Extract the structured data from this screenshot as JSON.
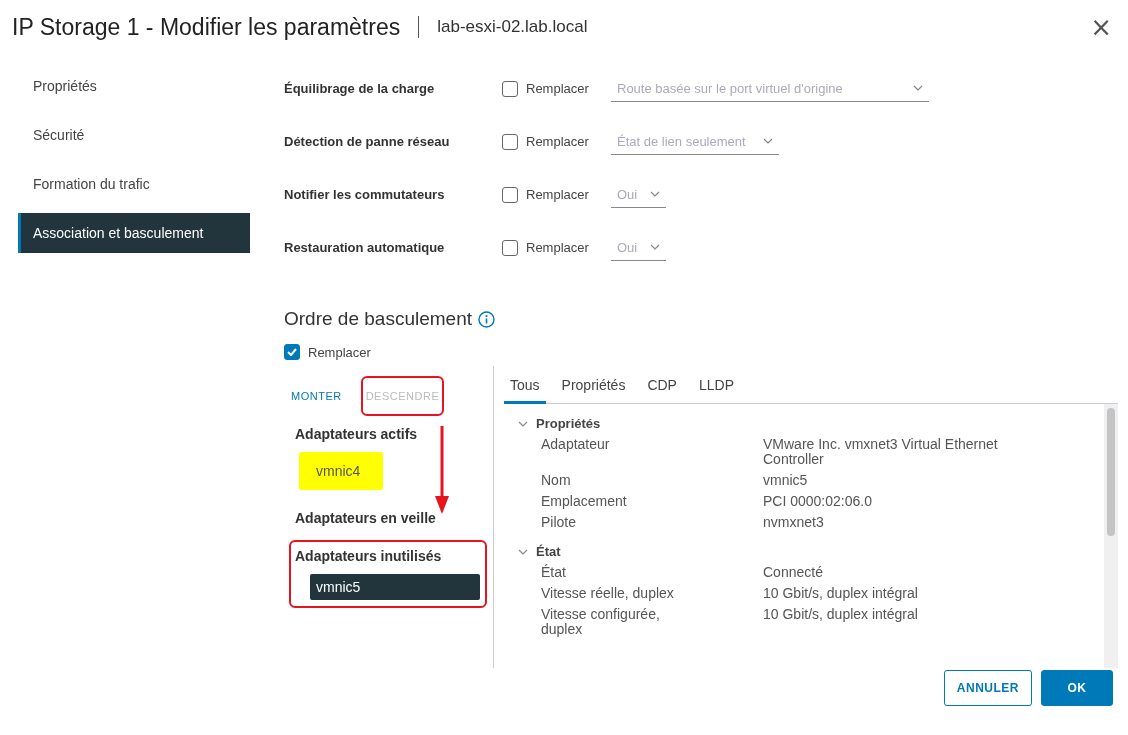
{
  "dialog": {
    "title": "IP Storage 1 - Modifier les paramètres",
    "host": "lab-esxi-02.lab.local",
    "close_label": "×"
  },
  "sidebar": {
    "items": [
      {
        "label": "Propriétés",
        "selected": false
      },
      {
        "label": "Sécurité",
        "selected": false
      },
      {
        "label": "Formation du trafic",
        "selected": false
      },
      {
        "label": "Association et basculement",
        "selected": true
      }
    ]
  },
  "settings": [
    {
      "label": "Équilibrage de la charge",
      "override_label": "Remplacer",
      "checked": false,
      "value": "Route basée sur le port virtuel d'origine"
    },
    {
      "label": "Détection de panne réseau",
      "override_label": "Remplacer",
      "checked": false,
      "value": "État de lien seulement"
    },
    {
      "label": "Notifier les commutateurs",
      "override_label": "Remplacer",
      "checked": false,
      "value": "Oui"
    },
    {
      "label": "Restauration automatique",
      "override_label": "Remplacer",
      "checked": false,
      "value": "Oui"
    }
  ],
  "failover": {
    "title": "Ordre de basculement",
    "override_label": "Remplacer",
    "override_checked": true,
    "buttons": [
      {
        "label": "MONTER",
        "disabled": false,
        "annotated": false
      },
      {
        "label": "DESCENDRE",
        "disabled": true,
        "annotated": true
      }
    ],
    "groups": [
      {
        "title": "Adaptateurs actifs",
        "annotated": false,
        "adapters": [
          {
            "name": "vmnic4",
            "selected": false,
            "highlighted": true
          }
        ]
      },
      {
        "title": "Adaptateurs en veille",
        "annotated": false
      },
      {
        "title": "Adaptateurs inutilisés",
        "annotated": true,
        "adapters": [
          {
            "name": "vmnic5",
            "selected": true,
            "highlighted": false
          }
        ]
      }
    ],
    "tabs": [
      {
        "label": "Tous",
        "selected": true
      },
      {
        "label": "Propriétés",
        "selected": false
      },
      {
        "label": "CDP",
        "selected": false
      },
      {
        "label": "LLDP",
        "selected": false
      }
    ],
    "sections": [
      {
        "title": "Propriétés",
        "expanded": true,
        "rows": [
          {
            "label": "Adaptateur",
            "value": "VMware Inc. vmxnet3 Virtual Ethernet Controller"
          },
          {
            "label": "Nom",
            "value": "vmnic5"
          },
          {
            "label": "Emplacement",
            "value": "PCI 0000:02:06.0"
          },
          {
            "label": "Pilote",
            "value": "nvmxnet3"
          }
        ]
      },
      {
        "title": "État",
        "expanded": true,
        "rows": [
          {
            "label": "État",
            "value": "Connecté"
          },
          {
            "label": "Vitesse réelle, duplex",
            "value": "10 Gbit/s, duplex intégral"
          },
          {
            "label": "Vitesse configurée, duplex",
            "value": "10 Gbit/s, duplex intégral"
          }
        ]
      }
    ]
  },
  "footer": {
    "buttons": [
      {
        "label": "ANNULER",
        "kind": "secondary"
      },
      {
        "label": "OK",
        "kind": "primary"
      }
    ]
  }
}
